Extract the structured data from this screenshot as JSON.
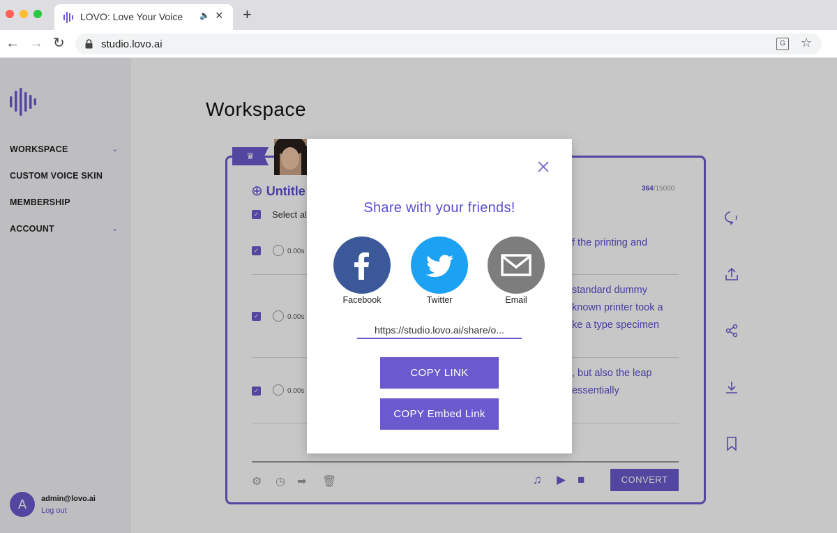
{
  "browser": {
    "tab_title": "LOVO: Love Your Voice",
    "url": "studio.lovo.ai",
    "traffic_colors": [
      "#ff5f57",
      "#febc2e",
      "#28c840"
    ]
  },
  "sidebar": {
    "items": [
      {
        "label": "WORKSPACE",
        "has_chevron": true
      },
      {
        "label": "CUSTOM VOICE SKIN",
        "has_chevron": false
      },
      {
        "label": "MEMBERSHIP",
        "has_chevron": false
      },
      {
        "label": "ACCOUNT",
        "has_chevron": true
      }
    ],
    "user": {
      "avatar_letter": "A",
      "email": "admin@lovo.ai",
      "logout_label": "Log out"
    }
  },
  "main": {
    "title": "Workspace",
    "project_title": "Untitle",
    "char_count": "364",
    "char_limit": "/15000",
    "select_all_label": "Select al",
    "rows": [
      {
        "duration": "0.00s",
        "lines": [
          "f the printing and"
        ]
      },
      {
        "duration": "0.00s",
        "lines": [
          "standard dummy",
          "known printer took a",
          "ke a type specimen"
        ]
      },
      {
        "duration": "0.00s",
        "lines": [
          ", but also the leap",
          "essentially"
        ]
      }
    ],
    "convert_label": "CONVERT"
  },
  "modal": {
    "heading": "Share with your friends!",
    "share_options": [
      {
        "label": "Facebook",
        "icon": "facebook-icon",
        "color": "#3b5998"
      },
      {
        "label": "Twitter",
        "icon": "twitter-icon",
        "color": "#1da1f2"
      },
      {
        "label": "Email",
        "icon": "email-icon",
        "color": "#7d7d7d"
      }
    ],
    "share_link": "https://studio.lovo.ai/share/o...",
    "copy_link_label": "COPY LINK",
    "copy_embed_label": "COPY Embed Link"
  },
  "colors": {
    "accent": "#6a5acd"
  }
}
